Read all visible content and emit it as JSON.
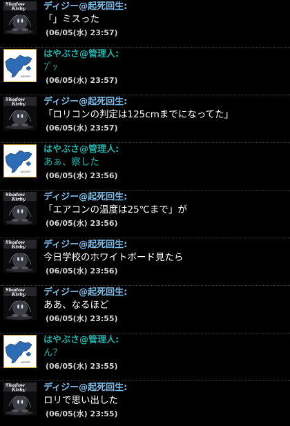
{
  "colors": {
    "background": "#000000",
    "daisy_name": "#7ec0ee",
    "daisy_text": "#ffffff",
    "hayabusa_name": "#20b2aa",
    "hayabusa_text": "#20b2aa",
    "timestamp": "#d4d4d4"
  },
  "avatars": {
    "daisy": {
      "icon": "shadow-kirby-avatar-icon",
      "line1": "Shadow",
      "line2": "Kirby"
    },
    "hayabusa": {
      "icon": "map-avatar-icon",
      "caption": "ADCDEF"
    }
  },
  "messages": [
    {
      "avatar": "daisy",
      "name": "ディジー@起死回生:",
      "text": "「」ミスった",
      "time": "(06/05(水) 23:57)"
    },
    {
      "avatar": "hayabusa",
      "name": "はやぶさ@管理人:",
      "text": "ﾌﾟｯ",
      "time": "(06/05(水) 23:57)"
    },
    {
      "avatar": "daisy",
      "name": "ディジー@起死回生:",
      "text": "「ロリコンの判定は125cmまでになってた」",
      "time": "(06/05(水) 23:57)"
    },
    {
      "avatar": "hayabusa",
      "name": "はやぶさ@管理人:",
      "text": "あぁ、察した",
      "time": "(06/05(水) 23:56)"
    },
    {
      "avatar": "daisy",
      "name": "ディジー@起死回生:",
      "text": "「エアコンの温度は25℃まで」が",
      "time": "(06/05(水) 23:56)"
    },
    {
      "avatar": "daisy",
      "name": "ディジー@起死回生:",
      "text": "今日学校のホワイトボード見たら",
      "time": "(06/05(水) 23:56)"
    },
    {
      "avatar": "daisy",
      "name": "ディジー@起死回生:",
      "text": "ああ、なるほど",
      "time": "(06/05(水) 23:55)"
    },
    {
      "avatar": "hayabusa",
      "name": "はやぶさ@管理人:",
      "text": "ん？",
      "time": "(06/05(水) 23:55)"
    },
    {
      "avatar": "daisy",
      "name": "ディジー@起死回生:",
      "text": "ロリで思い出した",
      "time": "(06/05(水) 23:55)"
    }
  ]
}
